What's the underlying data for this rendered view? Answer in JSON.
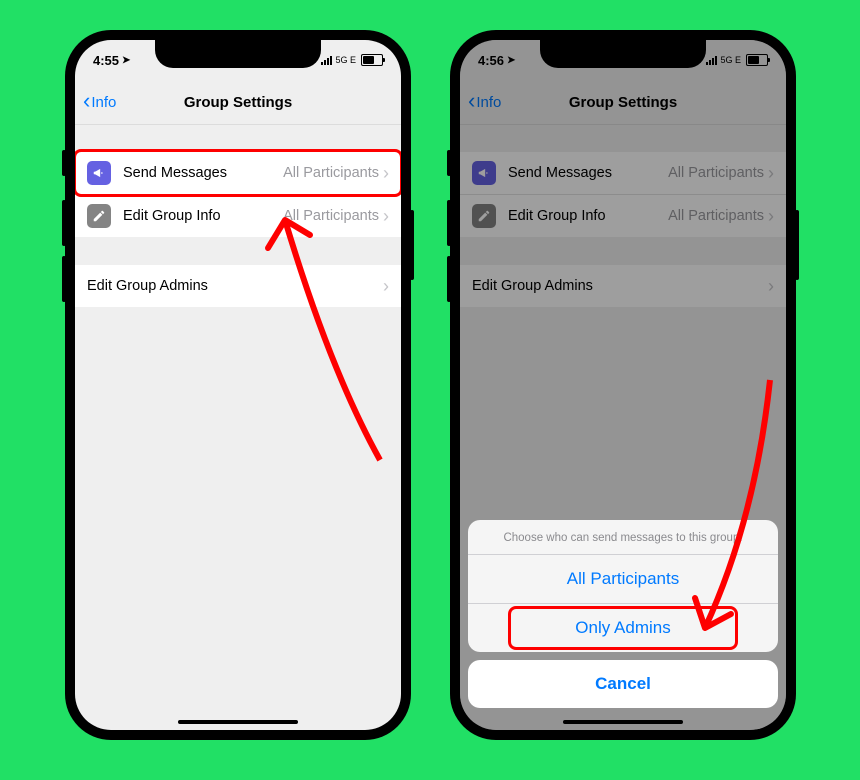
{
  "left": {
    "status": {
      "time": "4:55",
      "net": "5G E"
    },
    "nav": {
      "back": "Info",
      "title": "Group Settings"
    },
    "rows": {
      "sendMessages": {
        "label": "Send Messages",
        "value": "All Participants"
      },
      "editGroupInfo": {
        "label": "Edit Group Info",
        "value": "All Participants"
      },
      "editGroupAdmins": {
        "label": "Edit Group Admins"
      }
    }
  },
  "right": {
    "status": {
      "time": "4:56",
      "net": "5G E"
    },
    "nav": {
      "back": "Info",
      "title": "Group Settings"
    },
    "rows": {
      "sendMessages": {
        "label": "Send Messages",
        "value": "All Participants"
      },
      "editGroupInfo": {
        "label": "Edit Group Info",
        "value": "All Participants"
      },
      "editGroupAdmins": {
        "label": "Edit Group Admins"
      }
    },
    "sheet": {
      "title": "Choose who can send messages to this group.",
      "opt1": "All Participants",
      "opt2": "Only Admins",
      "cancel": "Cancel"
    }
  }
}
